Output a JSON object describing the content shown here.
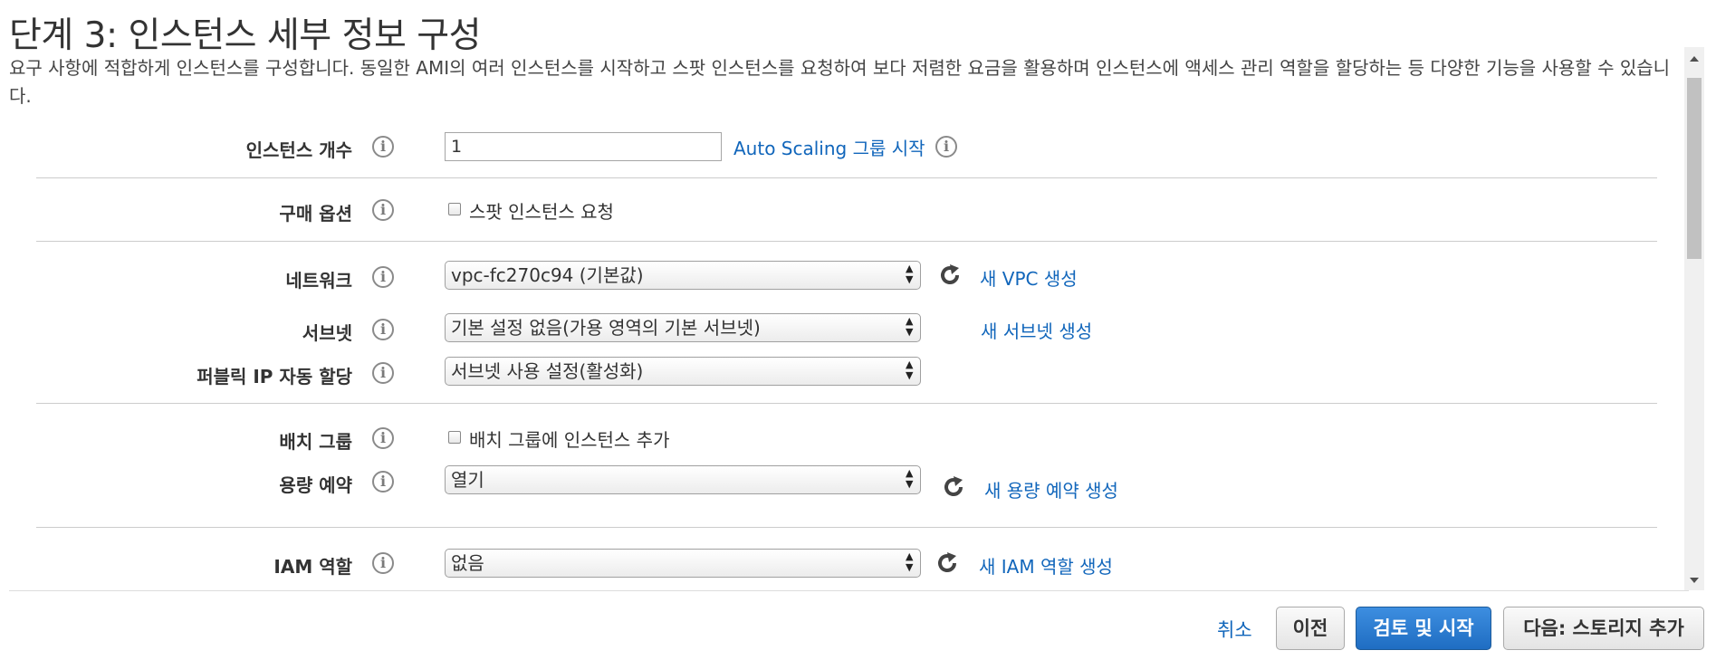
{
  "page": {
    "title": "단계 3: 인스턴스 세부 정보 구성",
    "description": "요구 사항에 적합하게 인스턴스를 구성합니다. 동일한 AMI의 여러 인스턴스를 시작하고 스팟 인스턴스를 요청하여 보다 저렴한 요금을 활용하며 인스턴스에 액세스 관리 역할을 할당하는 등 다양한 기능을 사용할 수 있습니다."
  },
  "fields": {
    "instance_count": {
      "label": "인스턴스 개수",
      "value": "1",
      "link": "Auto Scaling 그룹 시작"
    },
    "purchase_option": {
      "label": "구매 옵션",
      "checkbox_label": "스팟 인스턴스 요청"
    },
    "network": {
      "label": "네트워크",
      "selected": "vpc-fc270c94 (기본값)",
      "link": "새 VPC 생성"
    },
    "subnet": {
      "label": "서브넷",
      "selected": "기본 설정 없음(가용 영역의 기본 서브넷)",
      "link": "새 서브넷 생성"
    },
    "public_ip": {
      "label": "퍼블릭 IP 자동 할당",
      "selected": "서브넷 사용 설정(활성화)"
    },
    "placement_group": {
      "label": "배치 그룹",
      "checkbox_label": "배치 그룹에 인스턴스 추가"
    },
    "capacity_reservation": {
      "label": "용량 예약",
      "selected": "열기",
      "link": "새 용량 예약 생성"
    },
    "iam_role": {
      "label": "IAM 역할",
      "selected": "없음",
      "link": "새 IAM 역할 생성"
    }
  },
  "info_icon_glyph": "i",
  "select_arrows": "▲▼",
  "footer": {
    "cancel": "취소",
    "previous": "이전",
    "review_launch": "검토 및 시작",
    "next": "다음: 스토리지 추가"
  },
  "colors": {
    "link": "#1166bb",
    "primary_button": "#1f6dc2"
  }
}
